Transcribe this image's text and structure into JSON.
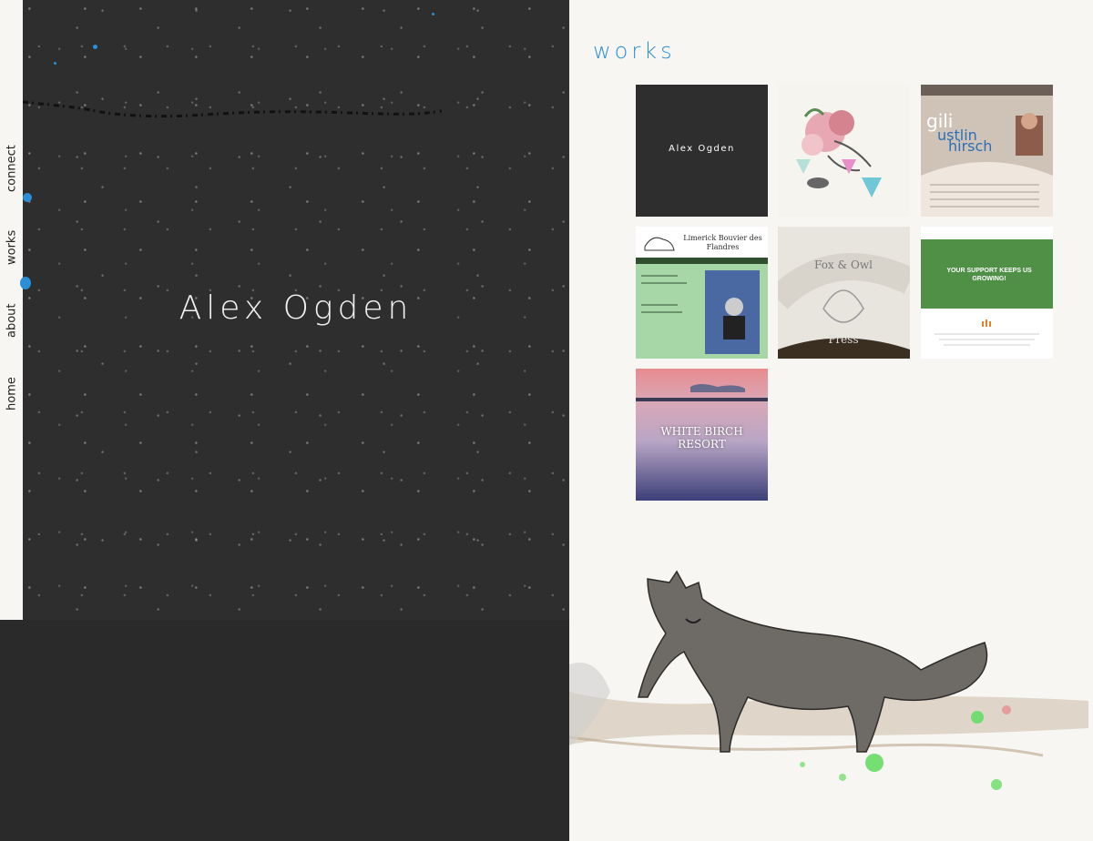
{
  "nav": {
    "items": [
      {
        "label": "connect"
      },
      {
        "label": "works"
      },
      {
        "label": "about"
      },
      {
        "label": "home"
      }
    ]
  },
  "hero": {
    "name": "Alex Ogden"
  },
  "works": {
    "title": "works",
    "thumbs": [
      {
        "caption": "Alex Ogden"
      },
      {
        "caption": ""
      },
      {
        "caption_1": "gili",
        "caption_2": "ustlin",
        "caption_3": "hirsch"
      },
      {
        "caption": "Limerick Bouvier des Flandres"
      },
      {
        "caption_1": "Fox & Owl",
        "caption_2": "Press"
      },
      {
        "caption": "YOUR SUPPORT KEEPS US GROWING!"
      },
      {
        "caption": "WHITE BIRCH RESORT"
      }
    ]
  },
  "colors": {
    "accent": "#2a8fd6",
    "hero_bg": "#2f2e2e",
    "page_bg": "#f7f6f3"
  }
}
